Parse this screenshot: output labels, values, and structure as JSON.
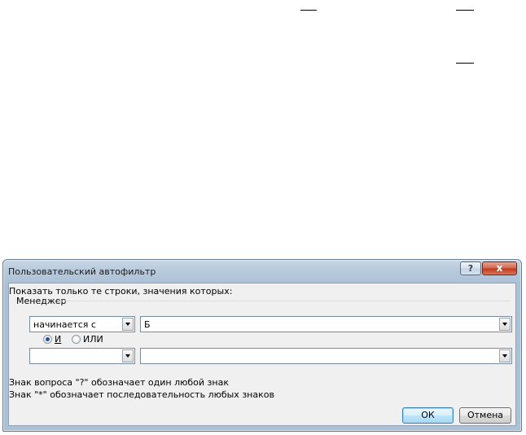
{
  "dialog": {
    "title": "Пользовательский автофильтр",
    "help_label": "?",
    "close_label": "x"
  },
  "filter": {
    "instruction": "Показать только те строки, значения которых:",
    "field_name": "Менеджер",
    "condition1": {
      "operator": "начинается с",
      "value": "Б"
    },
    "logic": {
      "and_label": "И",
      "or_label": "ИЛИ",
      "selected": "and"
    },
    "condition2": {
      "operator": "",
      "value": ""
    }
  },
  "hints": {
    "question_mark": "Знак вопроса \"?\" обозначает один любой знак",
    "asterisk": "Знак \"*\" обозначает последовательность любых знаков"
  },
  "buttons": {
    "ok": "ОК",
    "cancel": "Отмена"
  }
}
